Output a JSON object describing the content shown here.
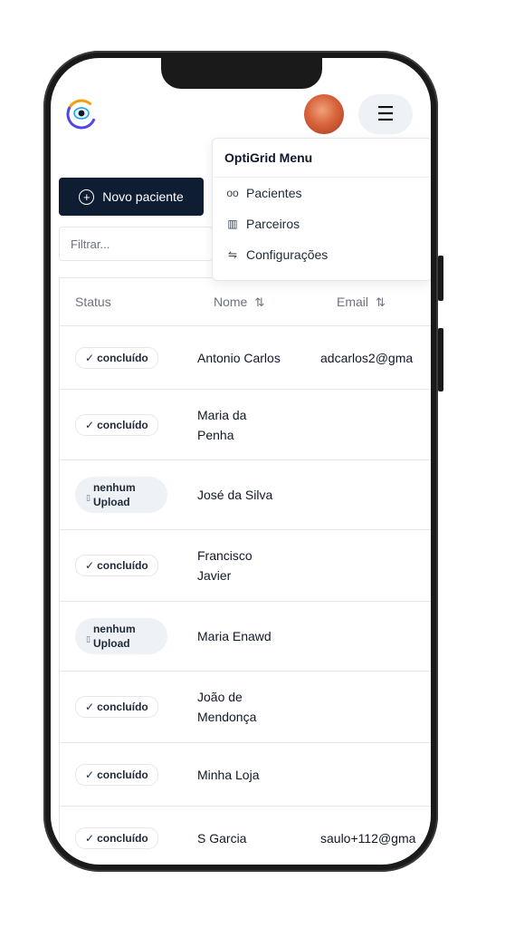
{
  "header": {
    "logo_icon": "eye-logo-icon",
    "avatar_icon": "user-avatar",
    "menu_icon": "hamburger-icon"
  },
  "menu": {
    "title": "OptiGrid Menu",
    "items": [
      {
        "label": "Pacientes",
        "icon": "glasses-icon"
      },
      {
        "label": "Parceiros",
        "icon": "building-icon"
      },
      {
        "label": "Configurações",
        "icon": "sliders-icon"
      }
    ]
  },
  "toolbar": {
    "new_patient_label": "Novo paciente",
    "filter_placeholder": "Filtrar..."
  },
  "table": {
    "columns": {
      "status": "Status",
      "name": "Nome",
      "email": "Email"
    },
    "rows": [
      {
        "status": "done",
        "status_label": "concluído",
        "name": "Antonio Carlos",
        "email": "adcarlos2@gma"
      },
      {
        "status": "done",
        "status_label": "concluído",
        "name": "Maria da Penha",
        "email": ""
      },
      {
        "status": "none",
        "status_label": "nenhum Upload",
        "name": "José da Silva",
        "email": ""
      },
      {
        "status": "done",
        "status_label": "concluído",
        "name": "Francisco Javier",
        "email": ""
      },
      {
        "status": "none",
        "status_label": "nenhum Upload",
        "name": "Maria Enawd",
        "email": ""
      },
      {
        "status": "done",
        "status_label": "concluído",
        "name": "João de Mendonça",
        "email": ""
      },
      {
        "status": "done",
        "status_label": "concluído",
        "name": "Minha Loja",
        "email": ""
      },
      {
        "status": "done",
        "status_label": "concluído",
        "name": "S Garcia",
        "email": "saulo+112@gma"
      }
    ]
  }
}
